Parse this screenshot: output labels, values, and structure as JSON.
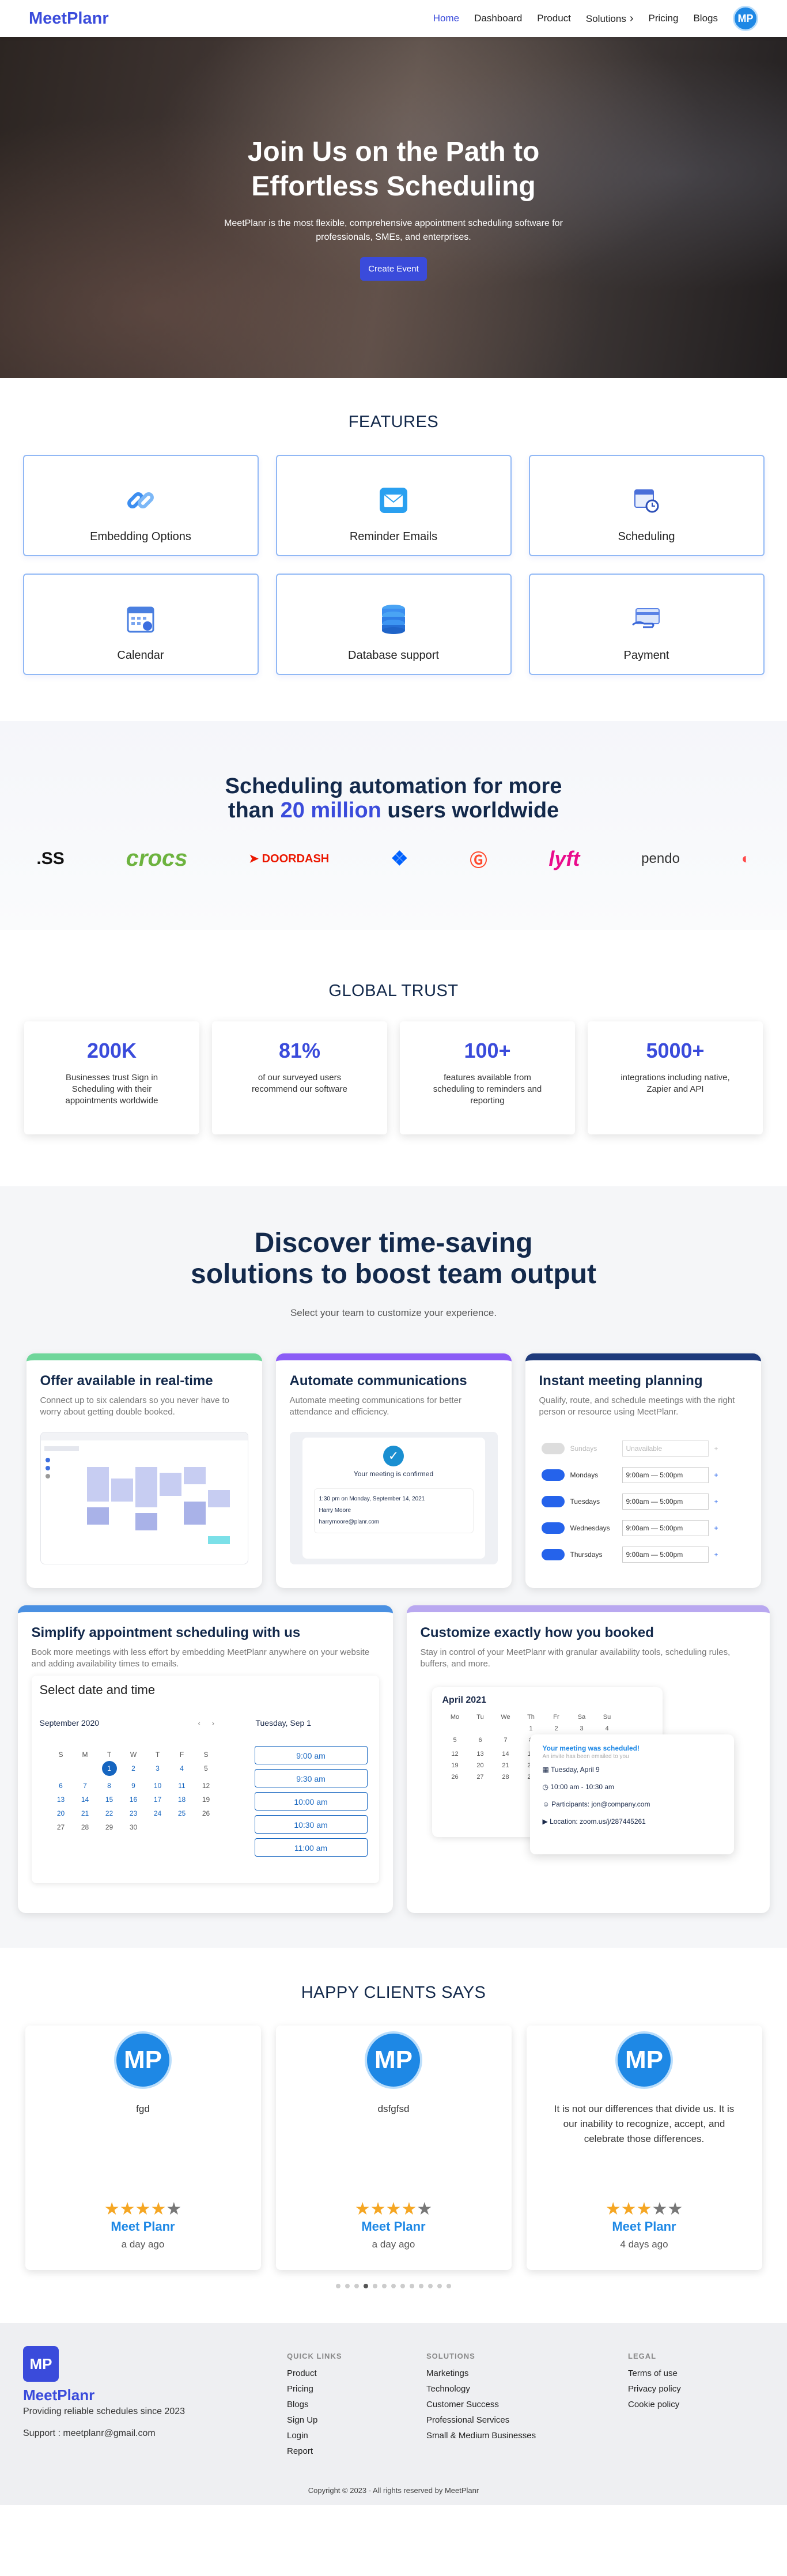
{
  "nav": {
    "logo": "MeetPlanr",
    "items": [
      "Home",
      "Dashboard",
      "Product",
      "Solutions",
      "Pricing",
      "Blogs"
    ],
    "avatar": "MP"
  },
  "hero": {
    "title": "Join Us on the Path to Effortless Scheduling",
    "desc": "MeetPlanr is the most flexible, comprehensive appointment scheduling software for professionals, SMEs, and enterprises.",
    "cta": "Create Event"
  },
  "features": {
    "title": "FEATURES",
    "items": [
      {
        "label": "Embedding Options",
        "icon": "link-icon"
      },
      {
        "label": "Reminder Emails",
        "icon": "email-icon"
      },
      {
        "label": "Scheduling",
        "icon": "calendar-clock-icon"
      },
      {
        "label": "Calendar",
        "icon": "calendar-icon"
      },
      {
        "label": "Database support",
        "icon": "database-icon"
      },
      {
        "label": "Payment",
        "icon": "payment-icon"
      }
    ]
  },
  "automation": {
    "title_a": "Scheduling automation for more",
    "title_b1": "than ",
    "title_hl": "20 million",
    "title_b2": " users worldwide",
    "logos": [
      ".SS",
      "crocs",
      "DOORDASH",
      "dropbox",
      "G2",
      "lyft",
      "pendo"
    ]
  },
  "trust": {
    "title": "GLOBAL TRUST",
    "items": [
      {
        "n": "200K",
        "d": "Businesses trust Sign in Scheduling with their appointments worldwide"
      },
      {
        "n": "81%",
        "d": "of our surveyed users recommend our software"
      },
      {
        "n": "100+",
        "d": "features available from scheduling to reminders and reporting"
      },
      {
        "n": "5000+",
        "d": "integrations including native, Zapier and API"
      }
    ]
  },
  "discover": {
    "title_a": "Discover time-saving",
    "title_b": "solutions to boost team output",
    "sub": "Select your team to customize your experience.",
    "cards": [
      {
        "t": "Offer available in real-time",
        "d": "Connect up to six calendars so you never have to worry about getting double booked.",
        "color": "#6fd69a"
      },
      {
        "t": "Automate communications",
        "d": "Automate meeting communications for better attendance and efficiency.",
        "color": "#8b5cf6"
      },
      {
        "t": "Instant meeting planning",
        "d": "Qualify, route, and schedule meetings with the right person or resource using MeetPlanr.",
        "color": "#1e3a7b"
      },
      {
        "t": "Simplify appointment scheduling with us",
        "d": "Book more meetings with less effort by embedding MeetPlanr anywhere on your website and adding availability times to emails.",
        "color": "#4a90e2"
      },
      {
        "t": "Customize exactly how you booked",
        "d": "Stay in control of your MeetPlanr with granular availability tools, scheduling rules, buffers, and more.",
        "color": "#b9a8f0"
      }
    ],
    "confirm": {
      "title": "Your meeting is confirmed",
      "line1": "1:30 pm on Monday, September 14, 2021",
      "name": "Harry Moore",
      "email": "harrymoore@planr.com"
    },
    "planning": {
      "rows": [
        {
          "day": "Sundays",
          "range": "Unavailable"
        },
        {
          "day": "Mondays",
          "range": "9:00am — 5:00pm"
        },
        {
          "day": "Tuesdays",
          "range": "9:00am — 5:00pm"
        },
        {
          "day": "Wednesdays",
          "range": "9:00am — 5:00pm"
        },
        {
          "day": "Thursdays",
          "range": "9:00am — 5:00pm"
        }
      ]
    },
    "booking": {
      "heading": "Select date and time",
      "month": "September 2020",
      "daylabel": "Tuesday, Sep 1",
      "wd": [
        "S",
        "M",
        "T",
        "W",
        "T",
        "F",
        "S"
      ],
      "slots": [
        "9:00 am",
        "9:30 am",
        "10:00 am",
        "10:30 am",
        "11:00 am"
      ]
    },
    "custom": {
      "month": "April 2021",
      "wd": [
        "Mo",
        "Tu",
        "We",
        "Th",
        "Fr",
        "Sa",
        "Su"
      ],
      "sched": "Your meeting was scheduled!",
      "schedsub": "An invite has been emailed to you",
      "date": "Tuesday, April 9",
      "time": "10:00 am - 10:30 am",
      "part": "Participants: jon@company.com",
      "loc": "Location: zoom.us/j/287445261"
    }
  },
  "clients": {
    "title": "HAPPY CLIENTS SAYS",
    "items": [
      {
        "txt": "fgd",
        "stars": 4,
        "name": "Meet Planr",
        "time": "a day ago"
      },
      {
        "txt": "dsfgfsd",
        "stars": 4,
        "name": "Meet Planr",
        "time": "a day ago"
      },
      {
        "txt": "It is not our differences that divide us. It is our inability to recognize, accept, and celebrate those differences.",
        "stars": 3,
        "name": "Meet Planr",
        "time": "4 days ago"
      }
    ]
  },
  "footer": {
    "brand": "MeetPlanr",
    "tag": "Providing reliable schedules since 2023",
    "support": "Support : meetplanr@gmail.com",
    "quick_title": "QUICK LINKS",
    "quick": [
      "Product",
      "Pricing",
      "Blogs",
      "Sign Up",
      "Login",
      "Report"
    ],
    "sol_title": "SOLUTIONS",
    "sol": [
      "Marketings",
      "Technology",
      "Customer Success",
      "Professional Services",
      "Small & Medium Businesses"
    ],
    "legal_title": "LEGAL",
    "legal": [
      "Terms of use",
      "Privacy policy",
      "Cookie policy"
    ],
    "copy": "Copyright © 2023 - All rights reserved by MeetPlanr"
  }
}
